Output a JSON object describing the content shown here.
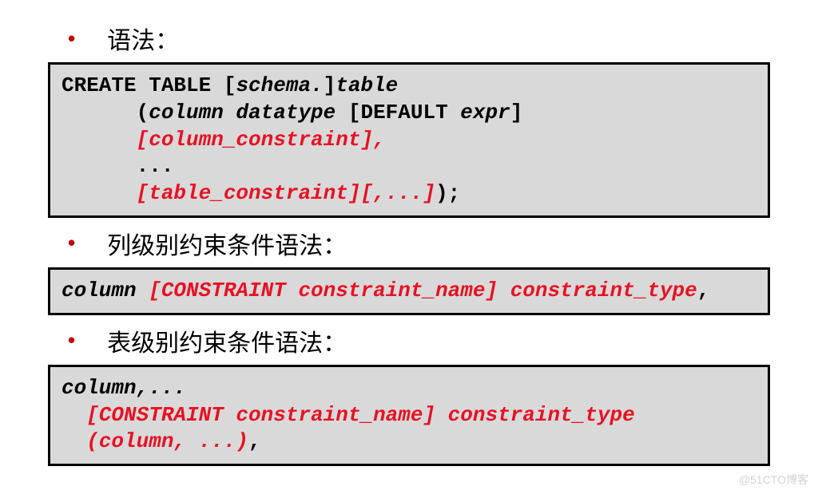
{
  "sections": {
    "syntax": {
      "label": "语法：",
      "code": {
        "line1_a": "CREATE TABLE [",
        "line1_b": "schema.",
        "line1_c": "]",
        "line1_d": "table",
        "line2_a": "      (",
        "line2_b": "column datatype ",
        "line2_c": "[DEFAULT ",
        "line2_d": "expr",
        "line2_e": "]",
        "line3": "      [column_constraint],",
        "line4": "      ...",
        "line5": "      [table_constraint][,...]",
        "line5_end": ");"
      }
    },
    "column_level": {
      "label": "列级别约束条件语法：",
      "code": {
        "part1": "column ",
        "part2": "[CONSTRAINT constraint_name] constraint_type",
        "part3": ","
      }
    },
    "table_level": {
      "label": "表级别约束条件语法：",
      "code": {
        "line1": "column,...",
        "line2": "  [CONSTRAINT constraint_name] constraint_type",
        "line3_a": "  (column, ...)",
        "line3_b": ","
      }
    }
  },
  "watermark": "@51CTO博客"
}
